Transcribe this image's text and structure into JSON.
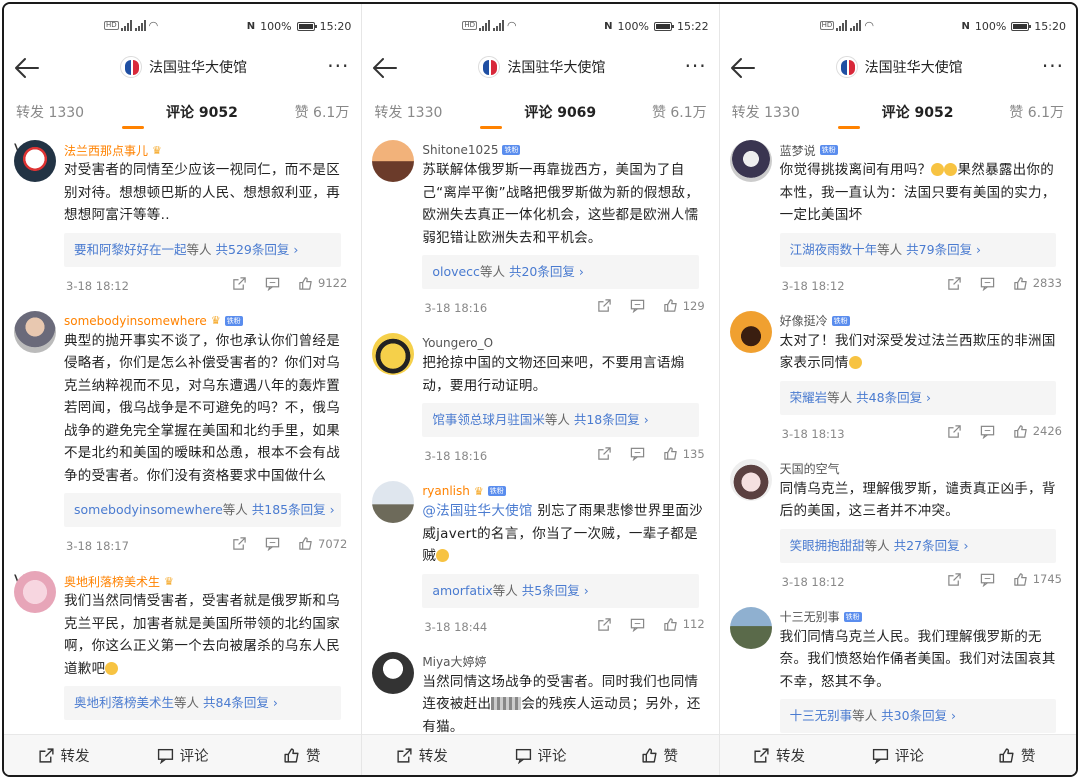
{
  "panels": [
    {
      "status": {
        "battery": "100%",
        "time": "15:20"
      },
      "nav": {
        "title": "法国驻华大使馆"
      },
      "tabs": {
        "repost": "转发 1330",
        "comment": "评论 9052",
        "like": "赞 6.1万"
      },
      "comments": [
        {
          "user": "法兰西那点事儿",
          "text": "对受害者的同情至少应该一视同仁，而不是区别对待。想想顿巴斯的人民、想想叙利亚，再想想阿富汗等等..",
          "reply_name": "要和阿黎好好在一起",
          "reply_mid": "等人",
          "reply_count": "共529条回复 ›",
          "time": "3-18 18:12",
          "likes": "9122"
        },
        {
          "user": "somebodyinsomewhere",
          "text": "典型的抛开事实不谈了，你也承认你们曾经是侵略者，你们是怎么补偿受害者的？你们对乌克兰纳粹视而不见，对乌东遭遇八年的轰炸置若罔闻，俄乌战争是不可避免的吗？不，俄乌战争的避免完全掌握在美国和北约手里，如果不是北约和美国的暧昧和怂恿，根本不会有战争的受害者。你们没有资格要求中国做什么",
          "reply_name": "somebodyinsomewhere",
          "reply_mid": "等人",
          "reply_count": "共185条回复 ›",
          "time": "3-18 18:17",
          "likes": "7072"
        },
        {
          "user": "奥地利落榜美术生",
          "text": "我们当然同情受害者，受害者就是俄罗斯和乌克兰平民，加害者就是美国所带领的北约国家啊，你这么正义第一个去向被屠杀的乌东人民道歉吧",
          "reply_name": "奥地利落榜美术生",
          "reply_mid": "等人",
          "reply_count": "共84条回复 ›",
          "time": "",
          "likes": ""
        }
      ],
      "bottom": {
        "repost": "转发",
        "comment": "评论",
        "like": "赞"
      }
    },
    {
      "status": {
        "battery": "100%",
        "time": "15:22"
      },
      "nav": {
        "title": "法国驻华大使馆"
      },
      "tabs": {
        "repost": "转发 1330",
        "comment": "评论 9069",
        "like": "赞 6.1万"
      },
      "comments": [
        {
          "user": "Shitone1025",
          "text": "苏联解体俄罗斯一再靠拢西方，美国为了自己“离岸平衡”战略把俄罗斯做为新的假想敌，欧洲失去真正一体化机会，这些都是欧洲人懦弱犯错让欧洲失去和平机会。",
          "reply_name": "olovecc",
          "reply_mid": "等人",
          "reply_count": "共20条回复 ›",
          "time": "3-18 18:16",
          "likes": "129"
        },
        {
          "user": "Youngero_O",
          "text": "把抢掠中国的文物还回来吧，不要用言语煽动，要用行动证明。",
          "reply_name": "馆事领总球月驻国米",
          "reply_mid": "等人",
          "reply_count": "共18条回复 ›",
          "time": "3-18 18:16",
          "likes": "135"
        },
        {
          "user": "ryanlish",
          "mention": "@法国驻华大使馆",
          "text": " 别忘了雨果悲惨世界里面沙威javert的名言，你当了一次贼，一辈子都是贼",
          "reply_name": "amorfatix",
          "reply_mid": "等人",
          "reply_count": "共5条回复 ›",
          "time": "3-18 18:44",
          "likes": "112"
        },
        {
          "user": "Miya大婷婷",
          "text_a": "当然同情这场战争的受害者。同时我们也同情连夜被赶出",
          "text_b": "会的残疾人运动员；另外，还有猫。",
          "time": "",
          "likes": ""
        }
      ],
      "bottom": {
        "repost": "转发",
        "comment": "评论",
        "like": "赞"
      }
    },
    {
      "status": {
        "battery": "100%",
        "time": "15:20"
      },
      "nav": {
        "title": "法国驻华大使馆"
      },
      "tabs": {
        "repost": "转发 1330",
        "comment": "评论 9052",
        "like": "赞 6.1万"
      },
      "comments": [
        {
          "user": "蓝梦说",
          "text_a": "你觉得挑拨离间有用吗？",
          "text_b": "果然暴露出你的本性，我一直认为：法国只要有美国的实力，一定比美国坏",
          "reply_name": "江湖夜雨数十年",
          "reply_mid": "等人",
          "reply_count": "共79条回复 ›",
          "time": "3-18 18:12",
          "likes": "2833"
        },
        {
          "user": "好像挺冷",
          "text": "太对了！我们对深受发过法兰西欺压的非洲国家表示同情",
          "reply_name": "荣耀岩",
          "reply_mid": "等人",
          "reply_count": "共48条回复 ›",
          "time": "3-18 18:13",
          "likes": "2426"
        },
        {
          "user": "天国的空气",
          "text": "同情乌克兰，理解俄罗斯，谴责真正凶手，背后的美国，这三者并不冲突。",
          "reply_name": "笑眼拥抱甜甜",
          "reply_mid": "等人",
          "reply_count": "共27条回复 ›",
          "time": "3-18 18:12",
          "likes": "1745"
        },
        {
          "user": "十三无别事",
          "text": "我们同情乌克兰人民。我们理解俄罗斯的无奈。我们愤怒始作俑者美国。我们对法国哀其不幸，怒其不争。",
          "reply_name": "十三无别事",
          "reply_mid": "等人",
          "reply_count": "共30条回复 ›",
          "time": "",
          "likes": ""
        }
      ],
      "bottom": {
        "repost": "转发",
        "comment": "评论",
        "like": "赞"
      }
    }
  ],
  "badges": {
    "fan": "铁粉"
  },
  "colors": {
    "accent": "#ff8200",
    "link": "#4a7bd0",
    "text": "#222222",
    "meta": "#888888"
  },
  "icons": [
    "back-arrow-icon",
    "more-icon",
    "crown-icon",
    "share-icon",
    "comment-icon",
    "like-icon"
  ]
}
